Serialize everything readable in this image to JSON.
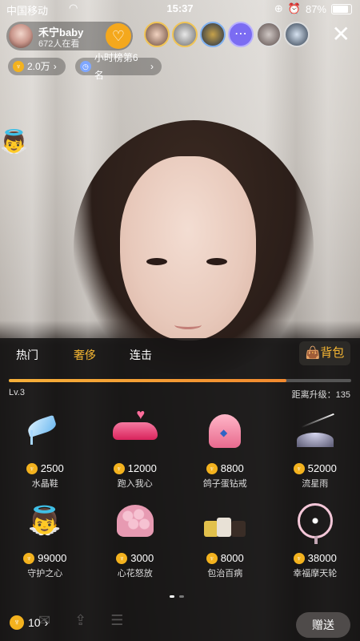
{
  "status_bar": {
    "carrier": "中国移动",
    "time": "15:37",
    "battery": "87%"
  },
  "host": {
    "name": "禾宁baby",
    "viewers": "672人在看"
  },
  "chips": {
    "coins": "2.0万",
    "rank": "小时榜第6名"
  },
  "gift_panel": {
    "tabs": [
      "热门",
      "奢侈",
      "连击"
    ],
    "active_tab_index": 1,
    "bag_label": "背包",
    "level": {
      "label": "Lv.3",
      "next_label": "距离升级：",
      "next_value": "135",
      "progress": 0.81
    },
    "gifts": [
      {
        "price": "2500",
        "name": "水晶鞋",
        "icon": "crystal-shoe"
      },
      {
        "price": "12000",
        "name": "跑入我心",
        "icon": "sports-car"
      },
      {
        "price": "8800",
        "name": "鸽子蛋钻戒",
        "icon": "ring-box"
      },
      {
        "price": "52000",
        "name": "流星雨",
        "icon": "meteor-shower"
      },
      {
        "price": "99000",
        "name": "守护之心",
        "icon": "cupid"
      },
      {
        "price": "3000",
        "name": "心花怒放",
        "icon": "rose-bouquet"
      },
      {
        "price": "8000",
        "name": "包治百病",
        "icon": "handbags"
      },
      {
        "price": "38000",
        "name": "幸福摩天轮",
        "icon": "ferris-wheel"
      }
    ],
    "page_dots": 2,
    "active_page": 0
  },
  "bottom_bar": {
    "balance": "10",
    "send_label": "赠送"
  },
  "colors": {
    "accent": "#f7b733",
    "follow": "#f4a81d",
    "panel_bg": "#161414"
  }
}
